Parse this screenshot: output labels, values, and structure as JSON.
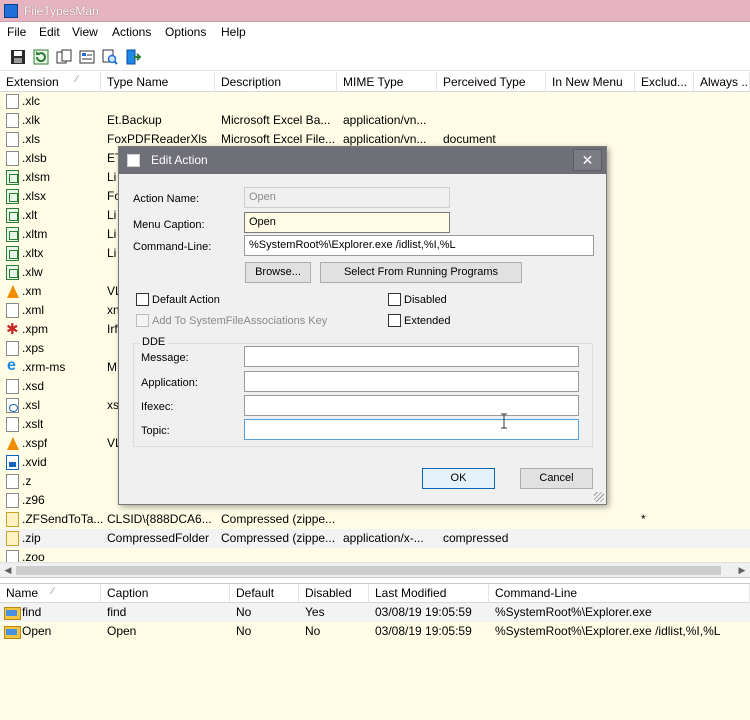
{
  "app": {
    "title": "FileTypesMan"
  },
  "menu": [
    "File",
    "Edit",
    "View",
    "Actions",
    "Options",
    "Help"
  ],
  "toolbar": [
    "save-icon",
    "refresh-icon",
    "copy-icon",
    "properties-icon",
    "find-icon",
    "exit-icon"
  ],
  "main_columns": [
    "Extension",
    "Type Name",
    "Description",
    "MIME Type",
    "Perceived Type",
    "In New Menu",
    "Exclud...",
    "Always ..."
  ],
  "main_rows": [
    {
      "ext": ".xlc",
      "type": "",
      "desc": "",
      "mime": "",
      "perc": "",
      "flag": "",
      "icon": "plain"
    },
    {
      "ext": ".xlk",
      "type": "Et.Backup",
      "desc": "Microsoft Excel Ba...",
      "mime": "application/vn...",
      "perc": "",
      "flag": "",
      "icon": "plain"
    },
    {
      "ext": ".xls",
      "type": "FoxPDFReaderXls",
      "desc": "Microsoft Excel File...",
      "mime": "application/vn...",
      "perc": "document",
      "flag": "",
      "icon": "plain"
    },
    {
      "ext": ".xlsb",
      "type": "ET",
      "desc": "",
      "mime": "",
      "perc": "",
      "flag": "",
      "icon": "plain"
    },
    {
      "ext": ".xlsm",
      "type": "Li",
      "desc": "",
      "mime": "",
      "perc": "",
      "flag": "",
      "icon": "green"
    },
    {
      "ext": ".xlsx",
      "type": "Fo",
      "desc": "",
      "mime": "",
      "perc": "",
      "flag": "",
      "icon": "green"
    },
    {
      "ext": ".xlt",
      "type": "Li",
      "desc": "",
      "mime": "",
      "perc": "",
      "flag": "",
      "icon": "green"
    },
    {
      "ext": ".xltm",
      "type": "Li",
      "desc": "",
      "mime": "",
      "perc": "",
      "flag": "",
      "icon": "green"
    },
    {
      "ext": ".xltx",
      "type": "Li",
      "desc": "",
      "mime": "",
      "perc": "",
      "flag": "",
      "icon": "green"
    },
    {
      "ext": ".xlw",
      "type": "",
      "desc": "",
      "mime": "",
      "perc": "",
      "flag": "",
      "icon": "green"
    },
    {
      "ext": ".xm",
      "type": "VL",
      "desc": "",
      "mime": "",
      "perc": "",
      "flag": "",
      "icon": "cone"
    },
    {
      "ext": ".xml",
      "type": "xn",
      "desc": "",
      "mime": "",
      "perc": "",
      "flag": "",
      "icon": "plain"
    },
    {
      "ext": ".xpm",
      "type": "Irf",
      "desc": "",
      "mime": "",
      "perc": "",
      "flag": "",
      "icon": "red"
    },
    {
      "ext": ".xps",
      "type": "",
      "desc": "",
      "mime": "",
      "perc": "",
      "flag": "",
      "icon": "plain"
    },
    {
      "ext": ".xrm-ms",
      "type": "M",
      "desc": "",
      "mime": "",
      "perc": "",
      "flag": "",
      "icon": "ie"
    },
    {
      "ext": ".xsd",
      "type": "",
      "desc": "",
      "mime": "",
      "perc": "",
      "flag": "",
      "icon": "plain"
    },
    {
      "ext": ".xsl",
      "type": "xs",
      "desc": "",
      "mime": "",
      "perc": "",
      "flag": "",
      "icon": "xsl"
    },
    {
      "ext": ".xslt",
      "type": "",
      "desc": "",
      "mime": "",
      "perc": "",
      "flag": "",
      "icon": "plain"
    },
    {
      "ext": ".xspf",
      "type": "VL",
      "desc": "",
      "mime": "",
      "perc": "",
      "flag": "",
      "icon": "cone"
    },
    {
      "ext": ".xvid",
      "type": "",
      "desc": "",
      "mime": "",
      "perc": "",
      "flag": "",
      "icon": "blue"
    },
    {
      "ext": ".z",
      "type": "",
      "desc": "",
      "mime": "",
      "perc": "",
      "flag": "",
      "icon": "plain"
    },
    {
      "ext": ".z96",
      "type": "",
      "desc": "",
      "mime": "",
      "perc": "",
      "flag": "",
      "icon": "plain"
    },
    {
      "ext": ".ZFSendToTa...",
      "type": "CLSID\\{888DCA6...",
      "desc": "Compressed (zippe...",
      "mime": "",
      "perc": "",
      "flag": "*",
      "icon": "zip"
    },
    {
      "ext": ".zip",
      "type": "CompressedFolder",
      "desc": "Compressed (zippe...",
      "mime": "application/x-...",
      "perc": "compressed",
      "flag": "",
      "icon": "zip"
    },
    {
      "ext": ".zoo",
      "type": "",
      "desc": "",
      "mime": "",
      "perc": "",
      "flag": "",
      "icon": "plain"
    }
  ],
  "actions_columns": [
    "Name",
    "Caption",
    "Default",
    "Disabled",
    "Last Modified",
    "Command-Line"
  ],
  "actions_rows": [
    {
      "name": "find",
      "caption": "find",
      "default": "No",
      "disabled": "Yes",
      "modified": "03/08/19 19:05:59",
      "cmd": "%SystemRoot%\\Explorer.exe"
    },
    {
      "name": "Open",
      "caption": "Open",
      "default": "No",
      "disabled": "No",
      "modified": "03/08/19 19:05:59",
      "cmd": "%SystemRoot%\\Explorer.exe /idlist,%I,%L"
    }
  ],
  "dialog": {
    "title": "Edit Action",
    "close": "✕",
    "action_name_label": "Action Name:",
    "action_name_value": "Open",
    "menu_caption_label": "Menu Caption:",
    "menu_caption_value": "Open",
    "command_line_label": "Command-Line:",
    "command_line_value": "%SystemRoot%\\Explorer.exe /idlist,%I,%L",
    "browse": "Browse...",
    "select_running": "Select From Running Programs",
    "default_action": "Default Action",
    "disabled": "Disabled",
    "add_to_sfa": "Add To SystemFileAssociations Key",
    "extended": "Extended",
    "dde_label": "DDE",
    "message_label": "Message:",
    "application_label": "Application:",
    "ifexec_label": "Ifexec:",
    "topic_label": "Topic:",
    "ok": "OK",
    "cancel": "Cancel"
  }
}
